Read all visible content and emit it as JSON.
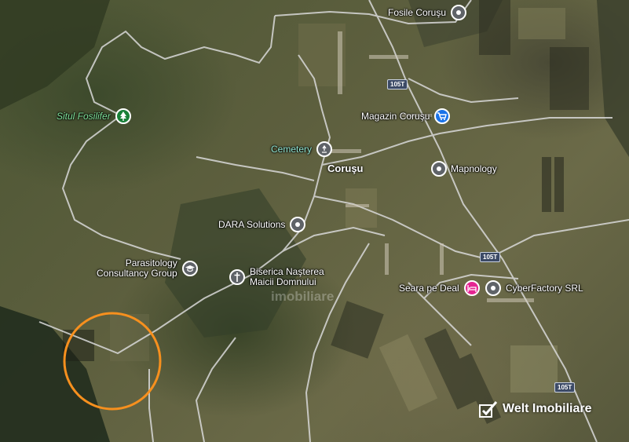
{
  "map": {
    "locality": "Coruşu",
    "watermark": {
      "center_text": "imobiliare",
      "brand": "Welt Imobiliare"
    },
    "road_shields": [
      "105T",
      "105T",
      "105T"
    ],
    "pois": [
      {
        "label": "Fosile Coruşu",
        "icon": "gray-pin-icon"
      },
      {
        "label": "Magazin Coruşu",
        "icon": "shopping-cart-icon"
      },
      {
        "label": "Situl Fosilifer",
        "icon": "park-tree-icon"
      },
      {
        "label": "Cemetery",
        "icon": "cemetery-icon"
      },
      {
        "label": "Mapnology",
        "icon": "gray-pin-icon"
      },
      {
        "label": "DARA Solutions",
        "icon": "gray-pin-icon"
      },
      {
        "label": "Parasitology Consultancy Group",
        "line1": "Parasitology",
        "line2": "Consultancy Group",
        "icon": "graduation-cap-icon"
      },
      {
        "label": "Biserica Naşterea Maicii Domnului",
        "line1": "Biserica Naşterea",
        "line2": "Maicii Domnului",
        "icon": "church-cross-icon"
      },
      {
        "label": "Seara pe Deal",
        "icon": "hotel-bed-icon"
      },
      {
        "label": "CyberFactory SRL",
        "icon": "gray-pin-icon"
      }
    ],
    "highlight": {
      "shape": "circle",
      "color": "#f7901e"
    },
    "colors": {
      "road": "#d9d9d9",
      "route": "#c9c9c9",
      "pin_gray": "#5f6368",
      "pin_blue": "#1a73e8",
      "pin_green": "#188038",
      "pin_pink": "#e52592"
    }
  }
}
